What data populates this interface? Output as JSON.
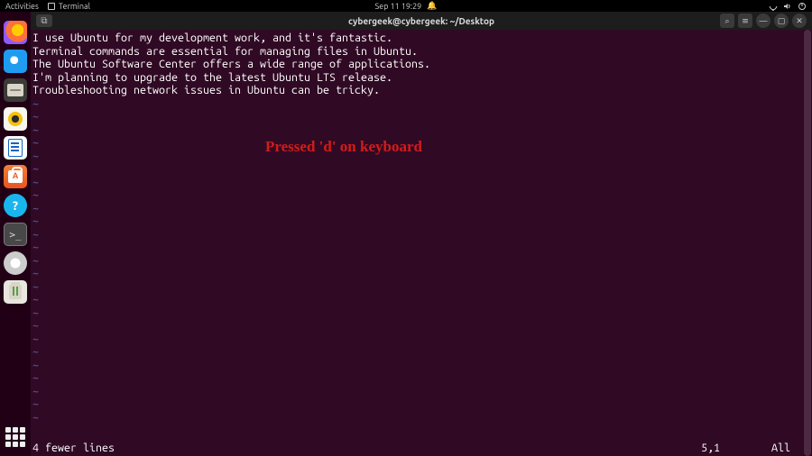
{
  "top_panel": {
    "activities": "Activities",
    "app_label": "Terminal",
    "clock": "Sep 11  19:29"
  },
  "titlebar": {
    "newtab_glyph": "⧉",
    "title": "cybergeek@cybergeek: ~/Desktop",
    "search_glyph": "⌕",
    "menu_glyph": "≡",
    "min_glyph": "—",
    "restore_glyph": "▢",
    "close_glyph": "✕"
  },
  "dock": {
    "help_glyph": "?",
    "terminal_glyph": ">_"
  },
  "editor": {
    "lines": [
      "I use Ubuntu for my development work, and it's fantastic.",
      "Terminal commands are essential for managing files in Ubuntu.",
      "The Ubuntu Software Center offers a wide range of applications.",
      "I'm planning to upgrade to the latest Ubuntu LTS release.",
      "Troubleshooting network issues in Ubuntu can be tricky."
    ],
    "status_message": "4 fewer lines",
    "cursor_position": "5,1",
    "scroll_indicator": "All"
  },
  "annotation": {
    "text": "Pressed 'd' on keyboard"
  }
}
